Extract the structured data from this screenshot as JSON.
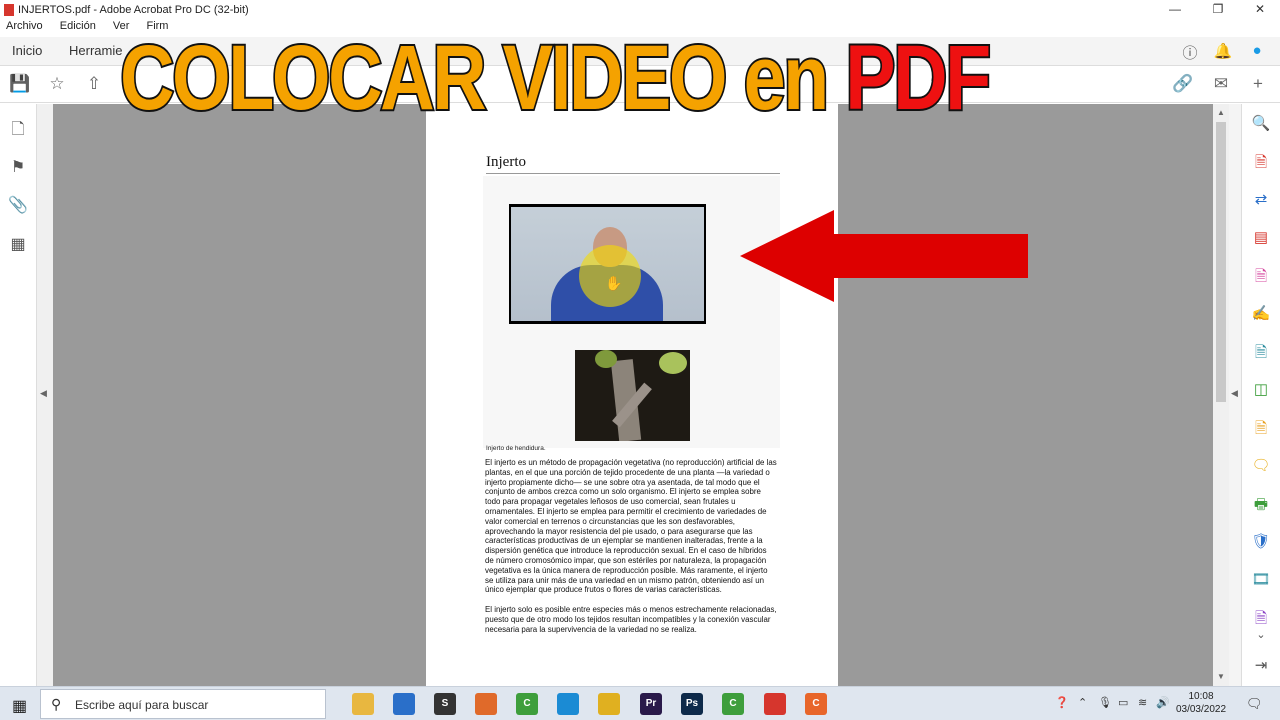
{
  "window": {
    "title": "INJERTOS.pdf - Adobe Acrobat Pro DC (32-bit)"
  },
  "menu": {
    "items": [
      "Archivo",
      "Edición",
      "Ver",
      "Firm"
    ]
  },
  "tabs": {
    "home": "Inicio",
    "tools": "Herramie"
  },
  "banner": {
    "part1": "COLOCAR VIDEO en",
    "part2": "PDF",
    "color1": "#f5a200",
    "color2": "#ee1111"
  },
  "document": {
    "heading": "Injerto",
    "caption": "Injerto de hendidura.",
    "paragraph1": "El injerto es un método de propagación vegetativa (no reproducción) artificial de las plantas, en el que una porción de tejido procedente de una planta —la variedad o injerto propiamente dicho— se une sobre otra ya asentada, de tal modo que el conjunto de ambos crezca como un solo organismo. El injerto se emplea sobre todo para propagar vegetales leñosos de uso comercial, sean frutales u ornamentales. El injerto se emplea para permitir el crecimiento de variedades de valor comercial en terrenos o circunstancias que les son desfavorables, aprovechando la mayor resistencia del pie usado, o para asegurarse que las características productivas de un ejemplar se mantienen inalteradas, frente a la dispersión genética que introduce la reproducción sexual. En el caso de híbridos de número cromosómico impar, que son estériles por naturaleza, la propagación vegetativa es la única manera de reproducción posible. Más raramente, el injerto se utiliza para unir más de una variedad en un mismo patrón, obteniendo así un único ejemplar que produce frutos o flores de varias características.",
    "paragraph2": "El injerto solo es posible entre especies más o menos estrechamente relacionadas, puesto que de otro modo los tejidos resultan incompatibles y la conexión vascular necesaria para la supervivencia de la variedad no se realiza."
  },
  "taskbar": {
    "search_placeholder": "Escribe aquí para buscar",
    "time": "10:08",
    "date": "03/03/2022",
    "apps": [
      {
        "name": "file-explorer",
        "color": "#e8b740",
        "label": ""
      },
      {
        "name": "mail",
        "color": "#2a6fc9",
        "label": ""
      },
      {
        "name": "app-s",
        "color": "#333333",
        "label": "S"
      },
      {
        "name": "app-circle",
        "color": "#e06a2a",
        "label": ""
      },
      {
        "name": "camtasia",
        "color": "#3e9e3c",
        "label": "C"
      },
      {
        "name": "edge",
        "color": "#1b8bd4",
        "label": ""
      },
      {
        "name": "chrome",
        "color": "#e0b020",
        "label": ""
      },
      {
        "name": "premiere",
        "color": "#2a1a4a",
        "label": "Pr"
      },
      {
        "name": "photoshop",
        "color": "#0e2a4a",
        "label": "Ps"
      },
      {
        "name": "camtasia-2",
        "color": "#3e9e3c",
        "label": "C"
      },
      {
        "name": "acrobat",
        "color": "#d6362d",
        "label": ""
      },
      {
        "name": "app-c-orange",
        "color": "#e8662a",
        "label": "C"
      }
    ]
  },
  "colors": {
    "accent_red": "#dd0000"
  }
}
